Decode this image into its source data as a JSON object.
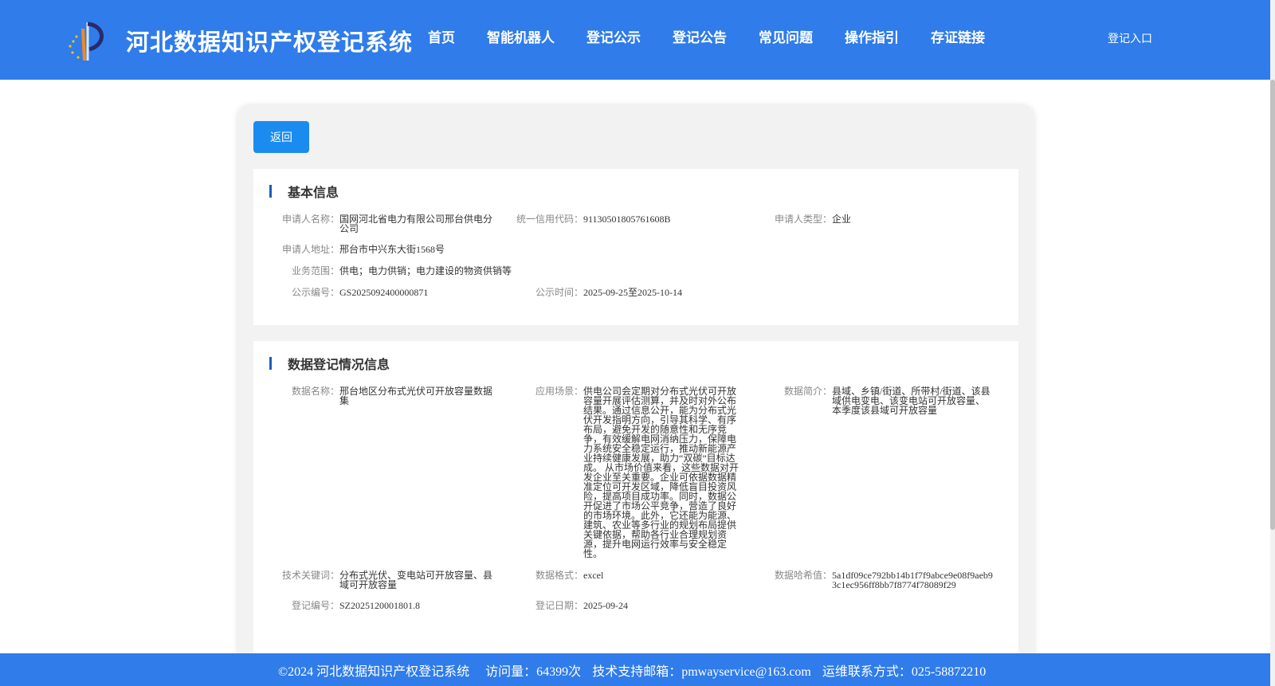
{
  "header": {
    "title": "河北数据知识产权登记系统",
    "nav": [
      "首页",
      "智能机器人",
      "登记公示",
      "登记公告",
      "常见问题",
      "操作指引",
      "存证链接"
    ],
    "login": "登记入口"
  },
  "back_label": "返回",
  "basic": {
    "title": "基本信息",
    "applicant_name_label": "申请人名称：",
    "applicant_name": "国网河北省电力有限公司邢台供电分公司",
    "credit_code_label": "统一信用代码：",
    "credit_code": "91130501805761608B",
    "applicant_type_label": "申请人类型：",
    "applicant_type": "企业",
    "address_label": "申请人地址：",
    "address": "邢台市中兴东大街1568号",
    "scope_label": "业务范围：",
    "scope": "供电；电力供销；电力建设的物资供销等",
    "pub_no_label": "公示编号：",
    "pub_no": "GS2025092400000871",
    "pub_time_label": "公示时间：",
    "pub_time": "2025-09-25至2025-10-14"
  },
  "registration": {
    "title": "数据登记情况信息",
    "data_name_label": "数据名称：",
    "data_name": "邢台地区分布式光伏可开放容量数据集",
    "scenario_label": "应用场景：",
    "scenario": "供电公司会定期对分布式光伏可开放容量开展评估测算，并及时对外公布结果。通过信息公开，能为分布式光伏开发指明方向，引导其科学、有序布局，避免开发的随意性和无序竞争，有效缓解电网消纳压力，保障电力系统安全稳定运行，推动新能源产业持续健康发展，助力“双碳”目标达成。 从市场价值来看，这些数据对开发企业至关重要。企业可依据数据精准定位可开发区域，降低盲目投资风险，提高项目成功率。同时，数据公开促进了市场公平竞争，营造了良好的市场环境。此外，它还能为能源、建筑、农业等多行业的规划布局提供关键依据，帮助各行业合理规划资源，提升电网运行效率与安全稳定性。",
    "intro_label": "数据简介：",
    "intro": "县域、乡镇/街道、所带村/街道、该县域供电变电、该变电站可开放容量、本季度该县域可开放容量",
    "keywords_label": "技术关键词：",
    "keywords": "分布式光伏、变电站可开放容量、县域可开放容量",
    "format_label": "数据格式：",
    "format": "excel",
    "hash_label": "数据哈希值：",
    "hash": "5a1df09ce792bb14b1f7f9abce9e08f9aeb93c1ec956ff8bb7f8774f78089f29",
    "reg_no_label": "登记编号：",
    "reg_no": "SZ2025120001801.8",
    "reg_date_label": "登记日期：",
    "reg_date": "2025-09-24"
  },
  "footer": {
    "copyright": "©2024 河北数据知识产权登记系统",
    "visits": "访问量：64399次",
    "email": "技术支持邮箱：pmwayservice@163.com",
    "phone": "运维联系方式：025-58872210"
  }
}
